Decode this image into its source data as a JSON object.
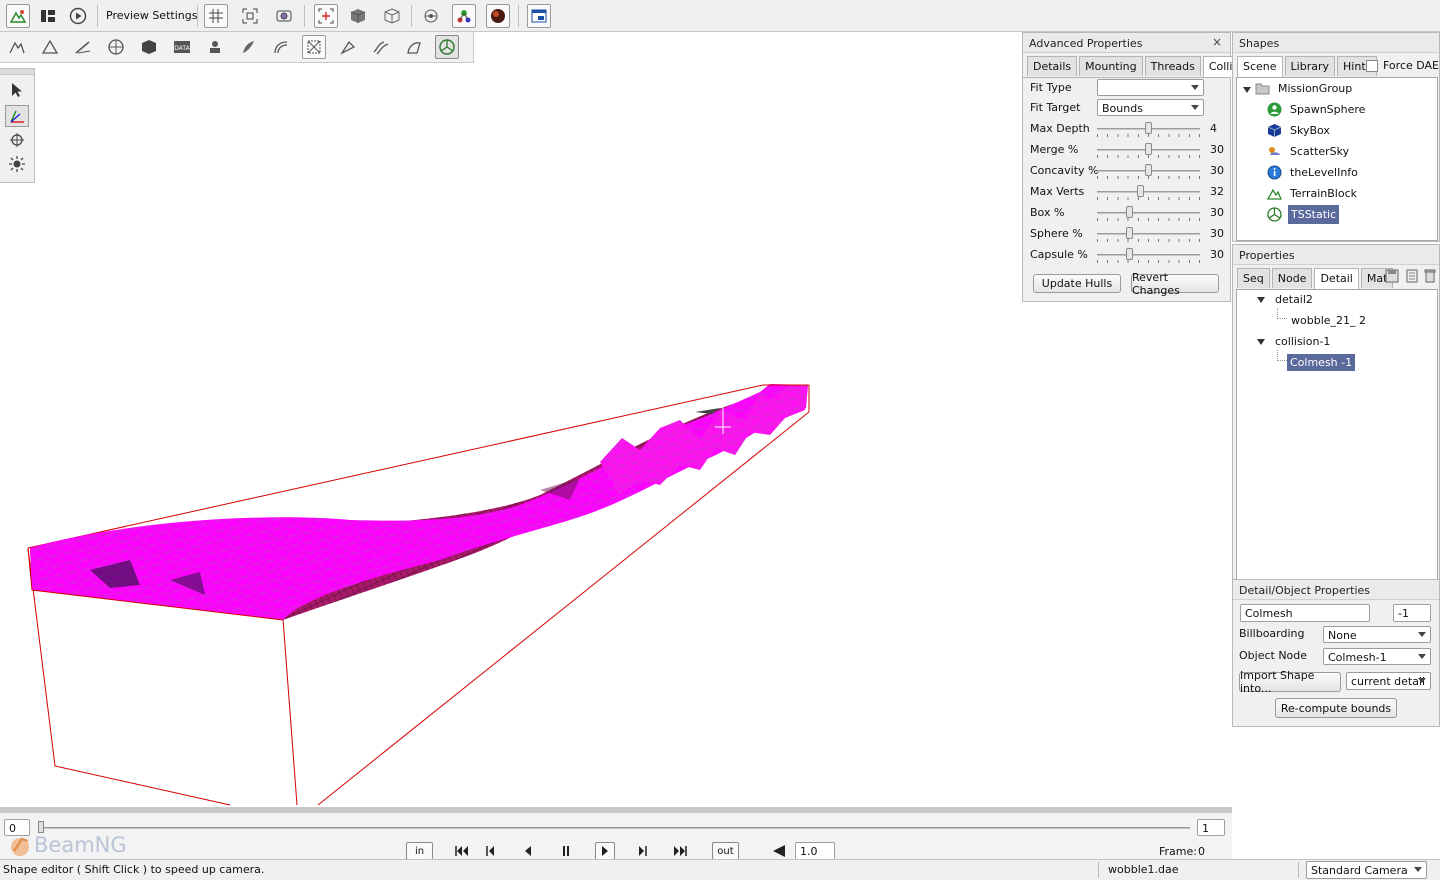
{
  "toolbar": {
    "preview_settings_label": "Preview Settings"
  },
  "advanced_properties": {
    "title": "Advanced Properties",
    "close_symbol": "×",
    "tabs": [
      "Details",
      "Mounting",
      "Threads",
      "Collision"
    ],
    "active_tab": "Collision",
    "fit_type": {
      "label": "Fit Type",
      "value": ""
    },
    "fit_target": {
      "label": "Fit Target",
      "value": "Bounds"
    },
    "sliders": [
      {
        "label": "Max Depth",
        "value": "4",
        "fraction": 0.5
      },
      {
        "label": "Merge %",
        "value": "30",
        "fraction": 0.5
      },
      {
        "label": "Concavity %",
        "value": "30",
        "fraction": 0.5
      },
      {
        "label": "Max Verts",
        "value": "32",
        "fraction": 0.42
      },
      {
        "label": "Box %",
        "value": "30",
        "fraction": 0.3
      },
      {
        "label": "Sphere %",
        "value": "30",
        "fraction": 0.3
      },
      {
        "label": "Capsule %",
        "value": "30",
        "fraction": 0.3
      }
    ],
    "update_hulls": "Update Hulls",
    "revert_changes": "Revert Changes"
  },
  "shapes": {
    "title": "Shapes",
    "tabs": [
      "Scene",
      "Library",
      "Hints"
    ],
    "active_tab": "Scene",
    "force_dae_label": "Force DAE",
    "tree": {
      "root": "MissionGroup",
      "items": [
        {
          "label": "SpawnSphere",
          "icon": "spawn-sphere-icon"
        },
        {
          "label": "SkyBox",
          "icon": "skybox-icon"
        },
        {
          "label": "ScatterSky",
          "icon": "scatter-sky-icon"
        },
        {
          "label": "theLevelInfo",
          "icon": "level-info-icon"
        },
        {
          "label": "TerrainBlock",
          "icon": "terrain-icon"
        },
        {
          "label": "TSStatic",
          "icon": "ts-static-icon",
          "selected": true
        }
      ]
    }
  },
  "properties": {
    "title": "Properties",
    "tabs": [
      "Seq",
      "Node",
      "Detail",
      "Mat"
    ],
    "active_tab": "Detail",
    "tree": {
      "detail": "detail2",
      "detail_child": "wobble_21_ 2",
      "collision": "collision-1",
      "collision_child": "Colmesh -1"
    }
  },
  "detail_object_properties": {
    "title": "Detail/Object Properties",
    "name_value": "Colmesh",
    "size_value": "-1",
    "billboarding_label": "Billboarding",
    "billboarding_value": "None",
    "object_node_label": "Object Node",
    "object_node_value": "Colmesh-1",
    "import_shape_label": "Import Shape into...",
    "import_target_value": "current detail",
    "recompute_bounds_label": "Re-compute bounds"
  },
  "timeline": {
    "start_value": "0",
    "end_value": "1",
    "in_label": "in",
    "out_label": "out",
    "speed_value": "1.0",
    "frame_label": "Frame:",
    "frame_value": "0",
    "brand": "BeamNG"
  },
  "statusbar": {
    "message": "Shape editor ( Shift Click ) to speed up camera.",
    "file": "wobble1.dae",
    "camera": "Standard Camera"
  },
  "colors": {
    "mesh_fill": "#ff00ff",
    "mesh_shadow": "#9b1a4c",
    "bounds_box": "#d40000",
    "selection": "#5b6a9c"
  }
}
